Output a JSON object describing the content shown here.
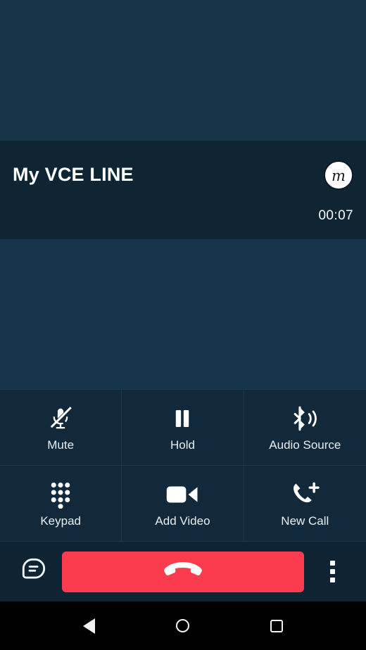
{
  "call": {
    "title": "My VCE LINE",
    "avatar_letter": "m",
    "duration": "00:07"
  },
  "controls": [
    {
      "label": "Mute",
      "icon": "microphone-off-icon"
    },
    {
      "label": "Hold",
      "icon": "pause-icon"
    },
    {
      "label": "Audio Source",
      "icon": "bluetooth-audio-icon"
    },
    {
      "label": "Keypad",
      "icon": "dialpad-icon"
    },
    {
      "label": "Add Video",
      "icon": "video-camera-icon"
    },
    {
      "label": "New Call",
      "icon": "phone-add-icon"
    }
  ],
  "action_bar": {
    "chat_icon": "chat-bubble-icon",
    "end_call_icon": "phone-hangup-icon",
    "more_icon": "overflow-menu-icon"
  },
  "nav_bar": {
    "back_icon": "back-triangle-icon",
    "home_icon": "home-circle-icon",
    "recents_icon": "recents-square-icon"
  },
  "colors": {
    "background": "#16334a",
    "header": "#102534",
    "grid": "#11293b",
    "action_bar": "#0e2333",
    "end_call_red": "#fb3c4e",
    "icon_white": "#ffffff",
    "nav_bar": "#000000"
  }
}
